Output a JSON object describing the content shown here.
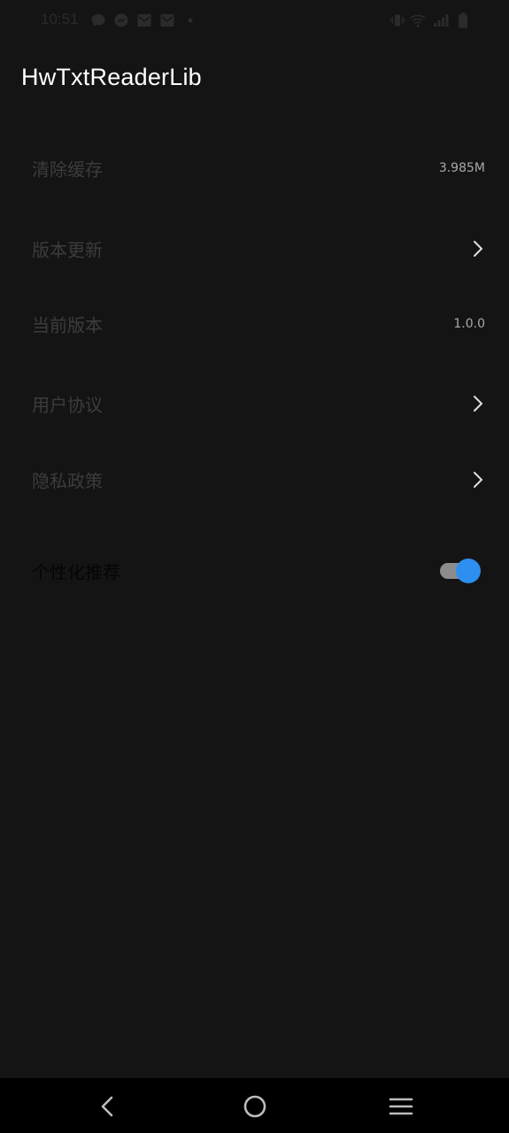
{
  "status_bar": {
    "time": "10:51",
    "left_icons": [
      "chat-bubble-icon",
      "messenger-icon",
      "mail-icon",
      "mail-icon",
      "dot-icon"
    ],
    "right_icons": [
      "vibrate-icon",
      "wifi-icon",
      "signal-icon",
      "battery-icon"
    ]
  },
  "app": {
    "title": "HwTxtReaderLib"
  },
  "settings": {
    "clear_cache": {
      "label": "清除缓存",
      "value": "3.985M"
    },
    "version_update": {
      "label": "版本更新"
    },
    "current_version": {
      "label": "当前版本",
      "value": "1.0.0"
    },
    "user_agreement": {
      "label": "用户协议"
    },
    "privacy_policy": {
      "label": "隐私政策"
    },
    "personalized_recommendation": {
      "label": "个性化推荐",
      "enabled": true
    }
  },
  "colors": {
    "background": "#141414",
    "toggle_accent": "#2d8ff0",
    "nav_background": "#000000"
  },
  "nav_bar": {
    "buttons": [
      "back-icon",
      "home-icon",
      "menu-icon"
    ]
  }
}
